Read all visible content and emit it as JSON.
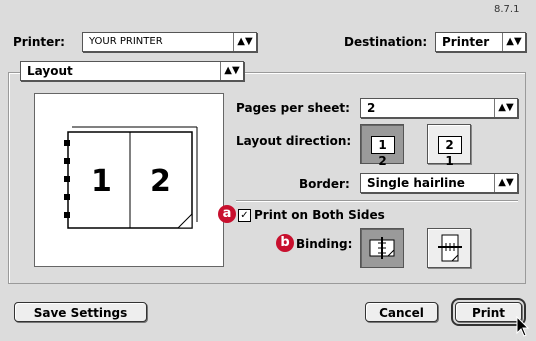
{
  "version": "8.7.1",
  "header": {
    "printer_label": "Printer:",
    "printer_value": "YOUR PRINTER",
    "destination_label": "Destination:",
    "destination_value": "Printer"
  },
  "panel_select": {
    "value": "Layout"
  },
  "layout": {
    "pages_per_sheet_label": "Pages per sheet:",
    "pages_per_sheet_value": "2",
    "layout_direction_label": "Layout direction:",
    "direction_options": [
      "1 2",
      "2 1"
    ],
    "border_label": "Border:",
    "border_value": "Single hairline",
    "preview_pages": [
      "1",
      "2"
    ]
  },
  "duplex": {
    "badge_a": "a",
    "print_both_sides_label": "Print on Both Sides",
    "print_both_sides_checked": true,
    "badge_b": "b",
    "binding_label": "Binding:"
  },
  "buttons": {
    "save_settings": "Save Settings",
    "cancel": "Cancel",
    "print": "Print"
  },
  "icons": {
    "arrows": "up-down-arrows-icon",
    "check": "checkmark-icon",
    "cursor": "mouse-pointer-icon"
  },
  "colors": {
    "badge": "#c8102e"
  }
}
